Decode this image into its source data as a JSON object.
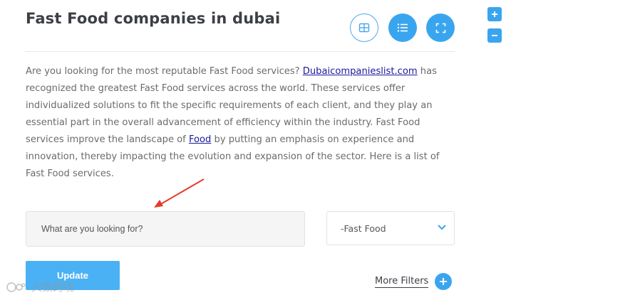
{
  "header": {
    "title": "Fast Food companies in dubai"
  },
  "view_buttons": {
    "grid_icon": "grid-icon",
    "list_icon": "list-icon",
    "fullscreen_icon": "fullscreen-icon"
  },
  "intro": {
    "part1": "Are you looking for the most reputable Fast Food services? ",
    "link1": "Dubaicompanieslist.com",
    "part2": " has recognized the greatest Fast Food services across the world. These services offer individualized solutions to fit the specific requirements of each client, and they play an essential part in the overall advancement of efficiency within the industry. Fast Food services improve the landscape of ",
    "link2": "Food",
    "part3": " by putting an emphasis on experience and innovation, thereby impacting the evolution and expansion of the sector. Here is a list of Fast Food services."
  },
  "search": {
    "placeholder": "What are you looking for?",
    "value": ""
  },
  "category": {
    "selected": "-Fast Food"
  },
  "actions": {
    "update_label": "Update",
    "more_filters_label": "More Filters"
  },
  "zoom": {
    "in_icon": "plus-icon",
    "out_icon": "minus-icon"
  },
  "watermark": {
    "text": "大数跨境"
  },
  "colors": {
    "accent": "#3aa5ef",
    "link": "#1a1a9e",
    "arrow": "#e53a2b"
  }
}
